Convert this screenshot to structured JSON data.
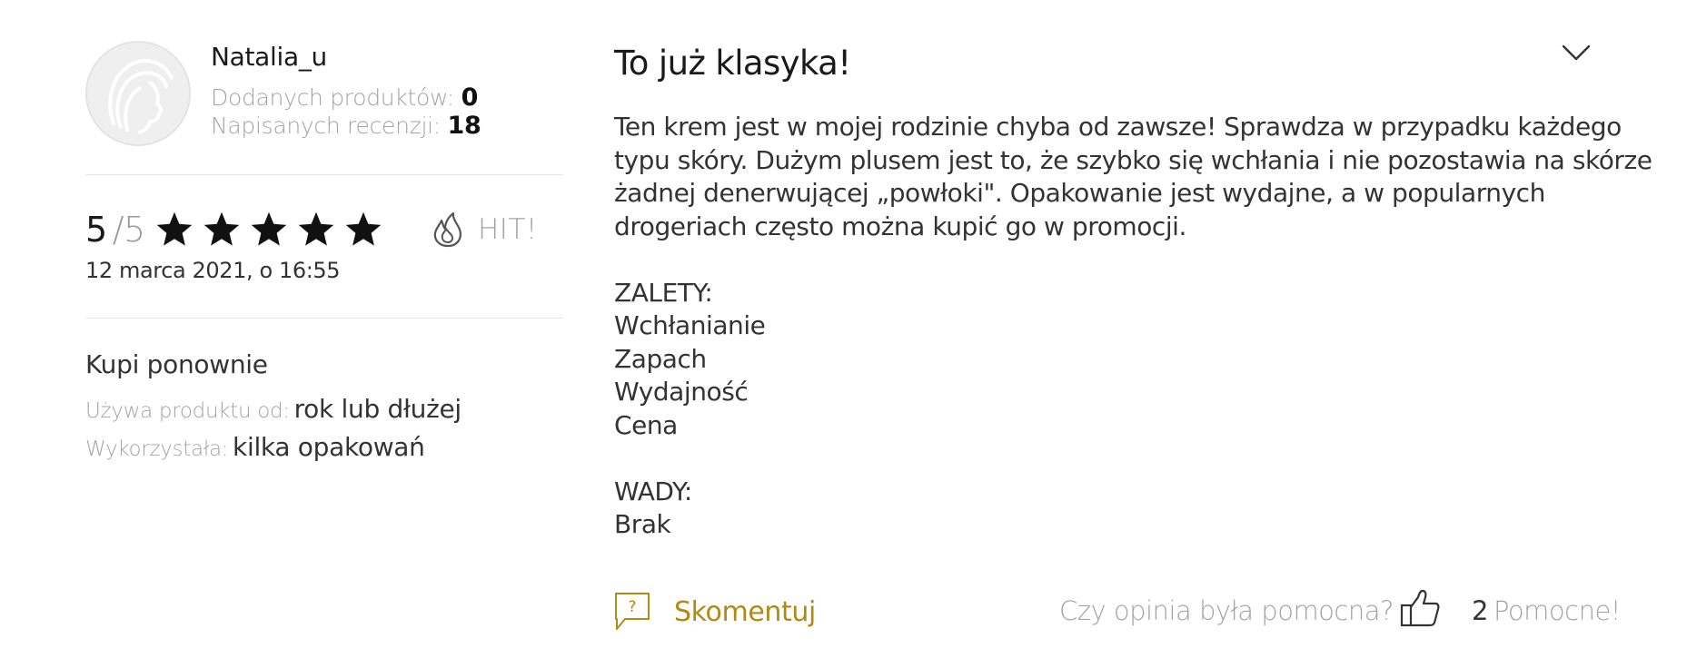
{
  "author": {
    "username": "Natalia_u",
    "added_products_label": "Dodanych produktów:",
    "added_products_count": "0",
    "reviews_label": "Napisanych recenzji:",
    "reviews_count": "18",
    "avatar_icon": "woman-profile-icon"
  },
  "rating": {
    "score": "5",
    "max": "/5",
    "stars": 5,
    "star_color": "#111111",
    "hit_icon": "flame-icon",
    "hit_label": "HIT!",
    "date": "12 marca 2021, o 16:55"
  },
  "usage": {
    "buy_again": "Kupi ponownie",
    "since_label": "Używa produktu od:",
    "since_value": "rok lub dłużej",
    "packs_label": "Wykorzystała:",
    "packs_value": "kilka opakowań"
  },
  "review": {
    "title": "To już klasyka!",
    "collapse_icon": "chevron-down-icon",
    "body_lines": [
      "Ten krem jest w mojej rodzinie chyba od zawsze! Sprawdza w przypadku każdego",
      "typu skóry. Dużym plusem jest to, że szybko się wchłania i nie pozostawia na skórze",
      "żadnej denerwującej „powłoki\". Opakowanie jest wydajne, a w popularnych",
      "drogeriach często można kupić go w promocji."
    ],
    "pros_heading": "ZALETY:",
    "pros": [
      "Wchłanianie",
      "Zapach",
      "Wydajność",
      "Cena"
    ],
    "cons_heading": "WADY:",
    "cons": [
      "Brak"
    ]
  },
  "actions": {
    "comment_label": "Skomentuj",
    "comment_icon": "comment-question-icon",
    "accent_color": "#b38a10",
    "helpful_question": "Czy opinia była pomocna?",
    "thumbs_icon": "thumbs-up-icon",
    "helpful_count": "2",
    "helpful_label": "Pomocne!"
  }
}
